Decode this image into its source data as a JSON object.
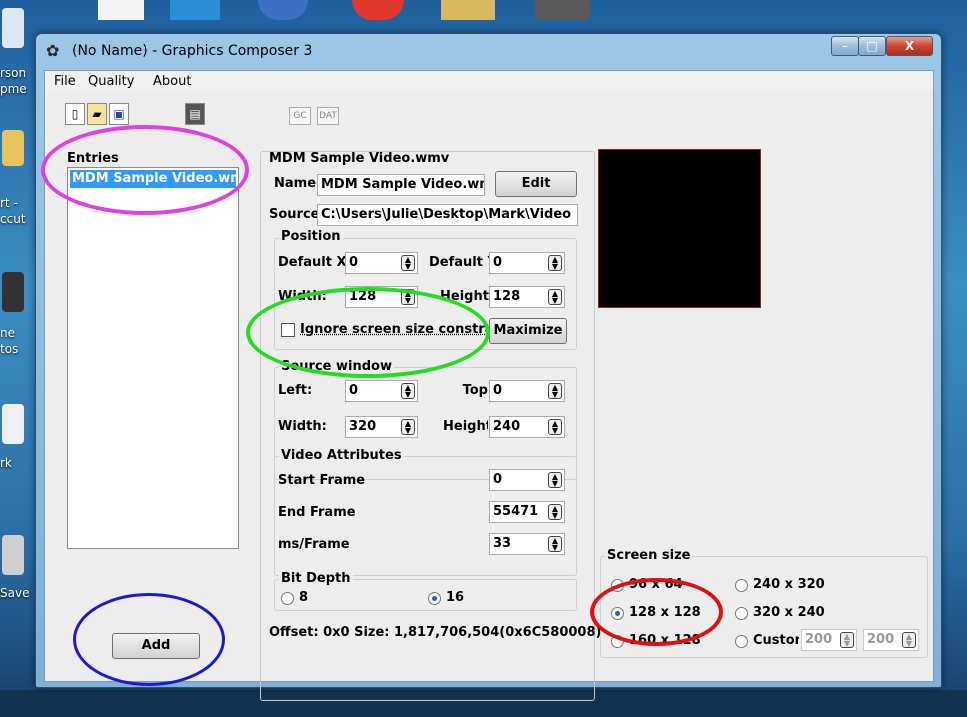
{
  "window": {
    "title": "(No Name) - Graphics Composer 3",
    "controls": {
      "minimize": "–",
      "maximize": "□",
      "close": "X"
    }
  },
  "desktop": {
    "labels": [
      "rson",
      "pme",
      "rt -",
      "ccut",
      "ne",
      "tos",
      "rk",
      "Save"
    ]
  },
  "menu": {
    "file": "File",
    "quality": "Quality",
    "about": "About"
  },
  "toolbar": {
    "gc": "GC",
    "dat": "DAT"
  },
  "entries": {
    "label": "Entries",
    "items": [
      "MDM Sample Video.wmv"
    ],
    "add_label": "Add"
  },
  "details": {
    "heading": "MDM Sample Video.wmv",
    "name_label": "Name",
    "name_value": "MDM Sample Video.wn",
    "edit_label": "Edit",
    "source_label": "Source",
    "source_value": "C:\\Users\\Julie\\Desktop\\Mark\\Video",
    "position": {
      "title": "Position",
      "default_x_label": "Default X:",
      "default_x": "0",
      "default_y_label": "Default Y",
      "default_y": "0",
      "width_label": "Width:",
      "width": "128",
      "height_label": "Height",
      "height": "128",
      "ignore_label": "Ignore screen size constra",
      "maximize_label": "Maximize"
    },
    "source_window": {
      "title": "Source window",
      "left_label": "Left:",
      "left": "0",
      "top_label": "Top",
      "top": "0",
      "width_label": "Width:",
      "width": "320",
      "height_label": "Height",
      "height": "240"
    },
    "video": {
      "title": "Video Attributes",
      "start_label": "Start Frame",
      "start": "0",
      "end_label": "End Frame",
      "end": "55471",
      "ms_label": "ms/Frame",
      "ms": "33"
    },
    "bit_depth": {
      "title": "Bit Depth",
      "opt8": "8",
      "opt16": "16",
      "selected": "16"
    },
    "footer": "Offset: 0x0  Size: 1,817,706,504(0x6C580008)"
  },
  "screen_size": {
    "title": "Screen size",
    "options": [
      "96 x 64",
      "240 x 320",
      "128 x 128",
      "320 x 240",
      "160 x 128",
      "Custom"
    ],
    "selected": "128 x 128",
    "custom_w": "200",
    "custom_h": "200"
  },
  "annotation_colors": {
    "magenta": "#e040e0",
    "green": "#22dd22",
    "blue": "#1a1ad0",
    "red": "#e01010"
  }
}
